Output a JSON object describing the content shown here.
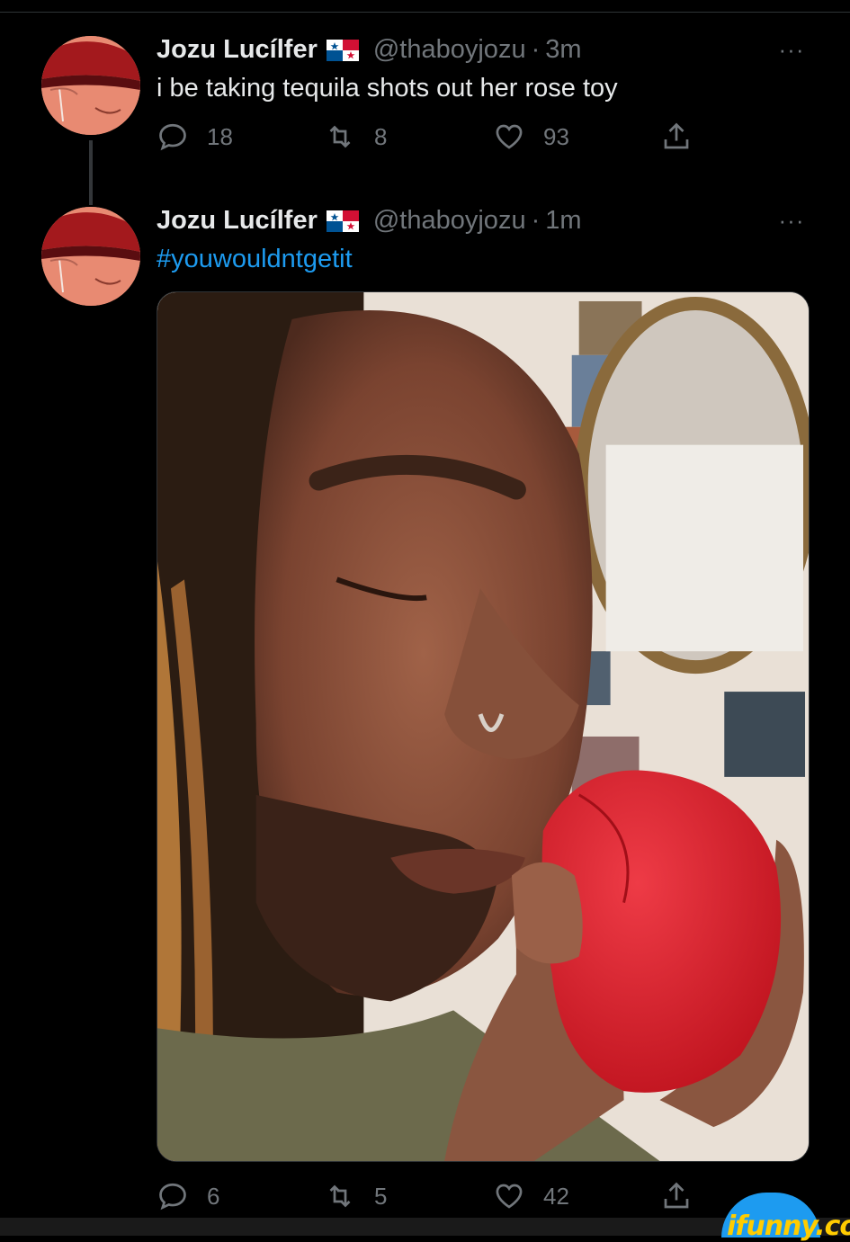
{
  "tweets": [
    {
      "author_name": "Jozu Lucílfer",
      "handle": "@thaboyjozu",
      "separator": "·",
      "time": "3m",
      "more": "···",
      "text": "i be taking tequila shots out her rose toy",
      "replies": "18",
      "retweets": "8",
      "likes": "93"
    },
    {
      "author_name": "Jozu Lucílfer",
      "handle": "@thaboyjozu",
      "separator": "·",
      "time": "1m",
      "more": "···",
      "hashtag": "#youwouldntgetit",
      "replies": "6",
      "retweets": "5",
      "likes": "42"
    }
  ],
  "watermark": "ifunny.co",
  "colors": {
    "background": "#000000",
    "text": "#e7e9ea",
    "muted": "#71767b",
    "link": "#1d9bf0",
    "watermark": "#ffcc00"
  },
  "icons": [
    "reply-icon",
    "retweet-icon",
    "like-icon",
    "share-icon",
    "panama-flag-icon",
    "more-icon"
  ]
}
